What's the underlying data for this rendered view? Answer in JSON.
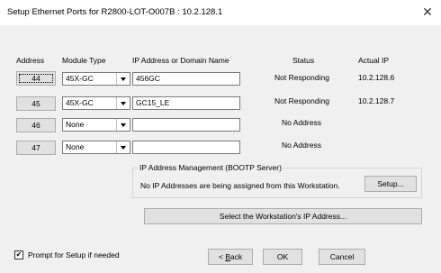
{
  "window": {
    "title": "Setup Ethernet Ports for R2800-LOT-O007B : 10.2.128.1",
    "close_glyph": "✕"
  },
  "columns": {
    "address": "Address",
    "module_type": "Module Type",
    "ip": "IP Address or Domain Name",
    "status": "Status",
    "actual_ip": "Actual IP"
  },
  "rows": [
    {
      "address": "44",
      "module": "45X-GC",
      "ip": "456GC",
      "status": "Not Responding",
      "actual_ip": "10.2.128.6"
    },
    {
      "address": "45",
      "module": "45X-GC",
      "ip": "GC15_LE",
      "status": "Not Responding",
      "actual_ip": "10.2.128.7"
    },
    {
      "address": "46",
      "module": "None",
      "ip": "",
      "status": "No Address",
      "actual_ip": ""
    },
    {
      "address": "47",
      "module": "None",
      "ip": "",
      "status": "No Address",
      "actual_ip": ""
    }
  ],
  "ip_management": {
    "title": "IP Address Management (BOOTP Server)",
    "message": "No IP Addresses are being assigned from this Workstation.",
    "setup_button": "Setup..."
  },
  "select_ip_button": "Select the Workstation's IP Address...",
  "prompt_checkbox": {
    "label": "Prompt for Setup if needed",
    "checked": true,
    "mark": "✔"
  },
  "buttons": {
    "back_prefix": "< ",
    "back_mnemonic": "B",
    "back_rest": "ack",
    "ok": "OK",
    "cancel": "Cancel"
  }
}
